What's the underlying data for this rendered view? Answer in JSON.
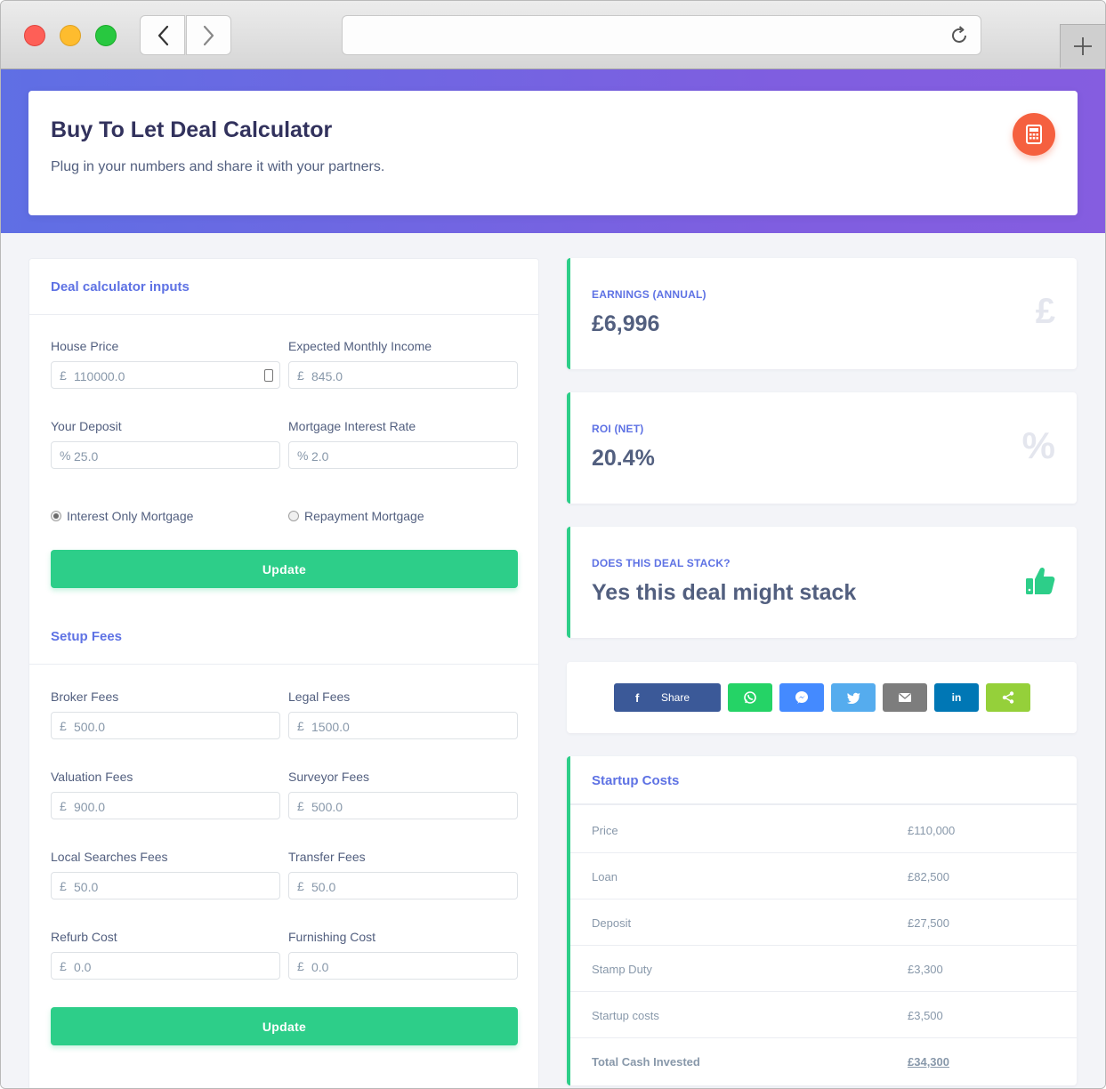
{
  "header": {
    "title": "Buy To Let Deal Calculator",
    "subtitle": "Plug in your numbers and share it with your partners.",
    "icon": "calculator-icon",
    "accent": "#f5603f"
  },
  "inputs": {
    "title": "Deal calculator inputs",
    "house_price": {
      "label": "House Price",
      "prefix": "£",
      "value": "110000.0"
    },
    "monthly_income": {
      "label": "Expected Monthly Income",
      "prefix": "£",
      "value": "845.0"
    },
    "deposit": {
      "label": "Your Deposit",
      "prefix": "%",
      "value": "25.0"
    },
    "interest_rate": {
      "label": "Mortgage Interest Rate",
      "prefix": "%",
      "value": "2.0"
    },
    "radio_interest_only": "Interest Only Mortgage",
    "radio_repayment": "Repayment Mortgage",
    "update_label": "Update"
  },
  "fees": {
    "title": "Setup Fees",
    "broker": {
      "label": "Broker Fees",
      "prefix": "£",
      "value": "500.0"
    },
    "legal": {
      "label": "Legal Fees",
      "prefix": "£",
      "value": "1500.0"
    },
    "valuation": {
      "label": "Valuation Fees",
      "prefix": "£",
      "value": "900.0"
    },
    "surveyor": {
      "label": "Surveyor Fees",
      "prefix": "£",
      "value": "500.0"
    },
    "local_searches": {
      "label": "Local Searches Fees",
      "prefix": "£",
      "value": "50.0"
    },
    "transfer": {
      "label": "Transfer Fees",
      "prefix": "£",
      "value": "50.0"
    },
    "refurb": {
      "label": "Refurb Cost",
      "prefix": "£",
      "value": "0.0"
    },
    "furnishing": {
      "label": "Furnishing Cost",
      "prefix": "£",
      "value": "0.0"
    },
    "update_label": "Update"
  },
  "stats": {
    "earnings": {
      "label": "EARNINGS (ANNUAL)",
      "value": "£6,996",
      "icon": "pound-icon"
    },
    "roi": {
      "label": "ROI (NET)",
      "value": "20.4%",
      "icon": "percent-icon"
    },
    "stack": {
      "label": "DOES THIS DEAL STACK?",
      "value": "Yes this deal might stack",
      "icon": "thumbs-up-icon"
    }
  },
  "share": {
    "facebook_label": "Share",
    "colors": {
      "facebook": "#3b5998",
      "whatsapp": "#25d366",
      "messenger": "#448aff",
      "twitter": "#55acee",
      "email": "#7d7d7d",
      "linkedin": "#0077b5",
      "sharethis": "#95d03a"
    }
  },
  "startup": {
    "title": "Startup Costs",
    "rows": [
      {
        "label": "Price",
        "value": "£110,000"
      },
      {
        "label": "Loan",
        "value": "£82,500"
      },
      {
        "label": "Deposit",
        "value": "£27,500"
      },
      {
        "label": "Stamp Duty",
        "value": "£3,300"
      },
      {
        "label": "Startup costs",
        "value": "£3,500"
      },
      {
        "label": "Total Cash Invested",
        "value": "£34,300"
      }
    ]
  }
}
